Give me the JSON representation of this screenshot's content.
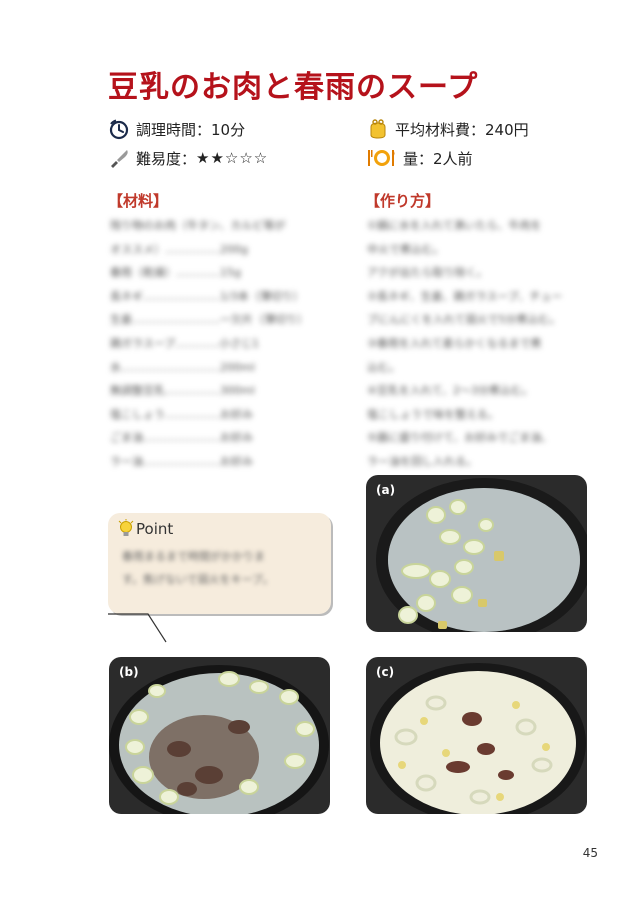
{
  "title": "豆乳のお肉と春雨のスープ",
  "meta": {
    "time": "調理時間：10分",
    "cost": "平均材料費：240円",
    "difficulty_label": "難易度：",
    "difficulty_level": 2,
    "difficulty_max": 5,
    "amount": "量：2人前"
  },
  "ingredients_heading": "【材料】",
  "steps_heading": "【作り方】",
  "ingredients_lines": [
    "残り物のお肉（牛タン、カルビ等が",
    "オススメ）……………200g",
    "春雨（乾燥）…………15g",
    "長ネギ…………………1/3本（薄切り）",
    "生姜……………………一欠片（薄切り）",
    "鶏ガラスープ…………小さじ1",
    "水………………………200ml",
    "無調整豆乳……………300ml",
    "塩こしょう……………お好み",
    "ごま油…………………お好み",
    "ラー油…………………お好み"
  ],
  "steps_lines": [
    "①鍋に水を入れて沸いたら、牛肉を",
    "中火で煮込む。",
    "アクが出たら取り除く。",
    "②長ネギ、生姜、鶏ガラスープ、チュー",
    "ブにんにくを入れて弱火で5分煮込む。",
    "③春雨を入れて柔らかくなるまで煮",
    "込む。",
    "④豆乳を入れて、2〜3分煮込む。",
    "塩こしょうで味を整える。",
    "⑤器に盛り付けて、お好みでごま油、",
    "ラー油を回し入れる。"
  ],
  "point": {
    "title": "Point",
    "lines": [
      "春雨まるまで時間がかかりま",
      "す。焦げないで弱火をキープ。"
    ]
  },
  "photos": {
    "a": "(a)",
    "b": "(b)",
    "c": "(c)"
  },
  "page_number": "45",
  "colors": {
    "title": "#b5121b",
    "section": "#c0392b",
    "point_bg": "#f6ecdd"
  }
}
